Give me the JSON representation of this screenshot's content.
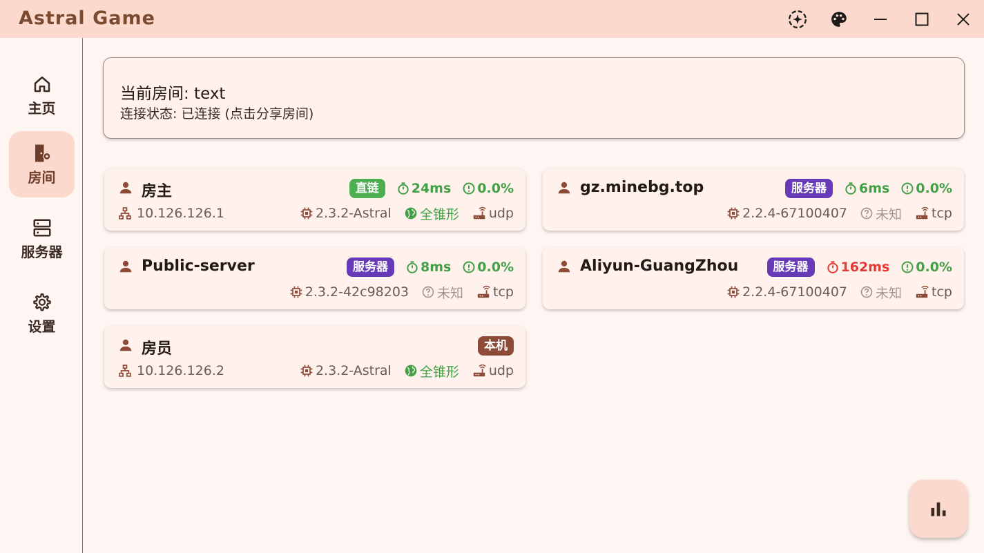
{
  "app": {
    "title": "Astral Game"
  },
  "nav": {
    "items": [
      {
        "label": "主页",
        "icon": "home-icon"
      },
      {
        "label": "房间",
        "icon": "room-settings-icon",
        "active": true
      },
      {
        "label": "服务器",
        "icon": "server-icon"
      },
      {
        "label": "设置",
        "icon": "gear-icon"
      }
    ]
  },
  "room": {
    "title": "当前房间: text",
    "status": "连接状态: 已连接 (点击分享房间)"
  },
  "players": [
    {
      "name": "房主",
      "badge": "直链",
      "badge_color": "#4caf50",
      "latency": "24ms",
      "latency_ok": true,
      "loss": "0.0%",
      "ip": "10.126.126.1",
      "version": "2.3.2-Astral",
      "nat": "全锥形",
      "nat_known": true,
      "protocol": "udp"
    },
    {
      "name": "gz.minebg.top",
      "badge": "服务器",
      "badge_color": "#673ab7",
      "latency": "6ms",
      "latency_ok": true,
      "loss": "0.0%",
      "ip": "",
      "version": "2.2.4-67100407",
      "nat": "未知",
      "nat_known": false,
      "protocol": "tcp"
    },
    {
      "name": "Public-server",
      "badge": "服务器",
      "badge_color": "#673ab7",
      "latency": "8ms",
      "latency_ok": true,
      "loss": "0.0%",
      "ip": "",
      "version": "2.3.2-42c98203",
      "nat": "未知",
      "nat_known": false,
      "protocol": "tcp"
    },
    {
      "name": "Aliyun-GuangZhou",
      "badge": "服务器",
      "badge_color": "#673ab7",
      "latency": "162ms",
      "latency_ok": false,
      "loss": "0.0%",
      "ip": "",
      "version": "2.2.4-67100407",
      "nat": "未知",
      "nat_known": false,
      "protocol": "tcp"
    },
    {
      "name": "房员",
      "badge": "本机",
      "badge_color": "#8d4a36",
      "ip": "10.126.126.2",
      "version": "2.3.2-Astral",
      "nat": "全锥形",
      "nat_known": true,
      "protocol": "udp"
    }
  ],
  "colors": {
    "accent": "#fcd9cd",
    "ok": "#43a047",
    "bad": "#e53935",
    "brand": "#7a4b30"
  }
}
